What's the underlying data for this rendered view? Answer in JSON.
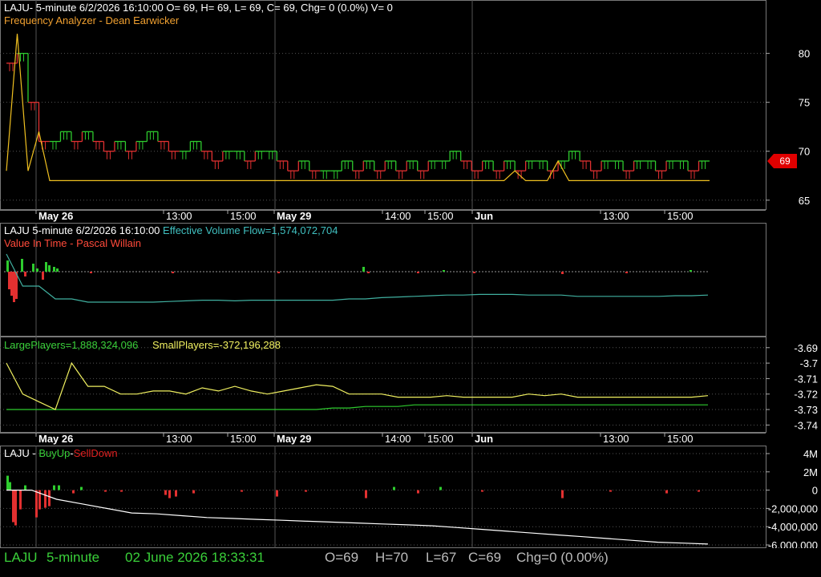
{
  "panel1": {
    "title": "LAJU- 5-minute 6/2/2026 16:10:00 O= 69, H= 69, L= 69, C= 69, Chg= 0 (0.0%) V= 0",
    "indicator": "Frequency Analyzer - Dean Earwicker",
    "price_badge": "69"
  },
  "panel2": {
    "title": "LAJU 5-minute  6/2/2026 16:10:00",
    "indicator": "Effective Volume Flow=1,574,072,704",
    "subtitle": "Value In Time - Pascal Willain"
  },
  "panel3": {
    "large": "LargePlayers=1,888,324,096",
    "small": "SmallPlayers=-372,196,288"
  },
  "panel4": {
    "ticker": "LAJU - ",
    "buy": "BuyUp",
    "dash": "-",
    "sell": "SellDown"
  },
  "status": {
    "ticker": "LAJU",
    "interval": "5-minute",
    "datetime": "02 June 2026 18:33:31",
    "o": "O=69",
    "h": "H=70",
    "l": "L=67",
    "c": "C=69",
    "chg": "Chg=0 (0.00%)"
  },
  "colors": {
    "up": "#2ecc2e",
    "down": "#e23030",
    "freq": "#f0c020",
    "evf": "#40b0a0",
    "large": "#2ecc2e",
    "small": "#f0f060",
    "grid": "#555555"
  },
  "chart_data": [
    {
      "type": "line",
      "name": "price",
      "yticks": [
        80,
        75,
        70,
        65
      ],
      "ylim": [
        64,
        83
      ],
      "x_dates": [
        "May 26",
        "13:00",
        "15:00",
        "May 29",
        "14:00",
        "15:00",
        "Jun",
        "13:00",
        "15:00"
      ],
      "last_price": 69,
      "close_series": [
        79,
        80,
        75,
        71,
        71,
        72,
        71,
        72,
        71,
        70,
        71,
        70,
        71,
        72,
        71,
        70,
        70,
        71,
        70,
        69,
        70,
        70,
        69,
        70,
        70,
        69,
        68,
        69,
        68,
        68,
        68,
        69,
        68,
        69,
        68,
        69,
        68,
        69,
        68,
        69,
        69,
        70,
        69,
        68,
        69,
        68,
        69,
        68,
        69,
        69,
        68,
        69,
        70,
        69,
        68,
        69,
        69,
        68,
        69,
        69,
        68,
        69,
        69,
        68,
        69,
        69
      ],
      "freq_series": [
        68,
        82,
        68,
        72,
        67,
        67,
        67,
        67,
        67,
        67,
        67,
        67,
        67,
        67,
        67,
        67,
        67,
        67,
        67,
        67,
        67,
        67,
        67,
        67,
        67,
        67,
        67,
        67,
        67,
        67,
        67,
        67,
        67,
        67,
        67,
        67,
        67,
        67,
        67,
        67,
        67,
        67,
        67,
        67,
        67,
        67,
        67,
        68,
        67,
        67,
        67,
        69,
        67,
        67,
        67,
        67,
        67,
        67,
        67,
        67,
        67,
        67,
        67,
        67,
        67,
        67
      ]
    },
    {
      "type": "bar",
      "name": "Effective Volume Flow",
      "evf_line": [
        -0.5,
        -1.0,
        -1.0,
        -1.2,
        -1.2,
        -1.25,
        -1.25,
        -1.25,
        -1.25,
        -1.25,
        -1.24,
        -1.23,
        -1.22,
        -1.22,
        -1.23,
        -1.22,
        -1.22,
        -1.22,
        -1.22,
        -1.22,
        -1.22,
        -1.2,
        -1.2,
        -1.18,
        -1.17,
        -1.16,
        -1.15,
        -1.14,
        -1.14,
        -1.13,
        -1.13,
        -1.13,
        -1.14,
        -1.14,
        -1.14,
        -1.16,
        -1.16,
        -1.16,
        -1.16,
        -1.16,
        -1.16,
        -1.15,
        -1.15,
        -1.14
      ]
    },
    {
      "type": "line",
      "name": "Players",
      "yticks": [
        -3.69,
        -3.7,
        -3.71,
        -3.72,
        -3.73,
        -3.74
      ],
      "ylim": [
        -3.745,
        -3.687
      ],
      "large": [
        -3.73,
        -3.73,
        -3.73,
        -3.73,
        -3.73,
        -3.73,
        -3.73,
        -3.73,
        -3.73,
        -3.73,
        -3.73,
        -3.73,
        -3.73,
        -3.73,
        -3.73,
        -3.73,
        -3.73,
        -3.73,
        -3.73,
        -3.73,
        -3.729,
        -3.729,
        -3.728,
        -3.728,
        -3.728,
        -3.727,
        -3.727,
        -3.727,
        -3.727,
        -3.727,
        -3.727,
        -3.727,
        -3.727,
        -3.727,
        -3.727,
        -3.727,
        -3.727,
        -3.727,
        -3.727,
        -3.727,
        -3.727,
        -3.727,
        -3.727,
        -3.727
      ],
      "small": [
        -3.7,
        -3.72,
        -3.725,
        -3.73,
        -3.7,
        -3.715,
        -3.715,
        -3.72,
        -3.72,
        -3.718,
        -3.718,
        -3.72,
        -3.716,
        -3.718,
        -3.715,
        -3.718,
        -3.72,
        -3.718,
        -3.716,
        -3.714,
        -3.715,
        -3.72,
        -3.72,
        -3.72,
        -3.722,
        -3.722,
        -3.722,
        -3.721,
        -3.722,
        -3.722,
        -3.722,
        -3.722,
        -3.72,
        -3.721,
        -3.72,
        -3.722,
        -3.722,
        -3.722,
        -3.722,
        -3.722,
        -3.722,
        -3.722,
        -3.722,
        -3.721
      ]
    },
    {
      "type": "bar",
      "name": "BuyUp-SellDown",
      "yticks": [
        "4M",
        "2M",
        "0",
        "-2,000,000",
        "-4,000,000",
        "-6,000,000"
      ],
      "ylim": [
        -6000000,
        4000000
      ],
      "cum_line": [
        0,
        0,
        -1000000,
        -1500000,
        -2000000,
        -2500000,
        -2600000,
        -2800000,
        -3000000,
        -3100000,
        -3200000,
        -3300000,
        -3400000,
        -3500000,
        -3600000,
        -3700000,
        -3800000,
        -3900000,
        -4100000,
        -4300000,
        -4500000,
        -4700000,
        -4900000,
        -5100000,
        -5300000,
        -5500000,
        -5700000,
        -5800000,
        -5900000
      ]
    }
  ]
}
